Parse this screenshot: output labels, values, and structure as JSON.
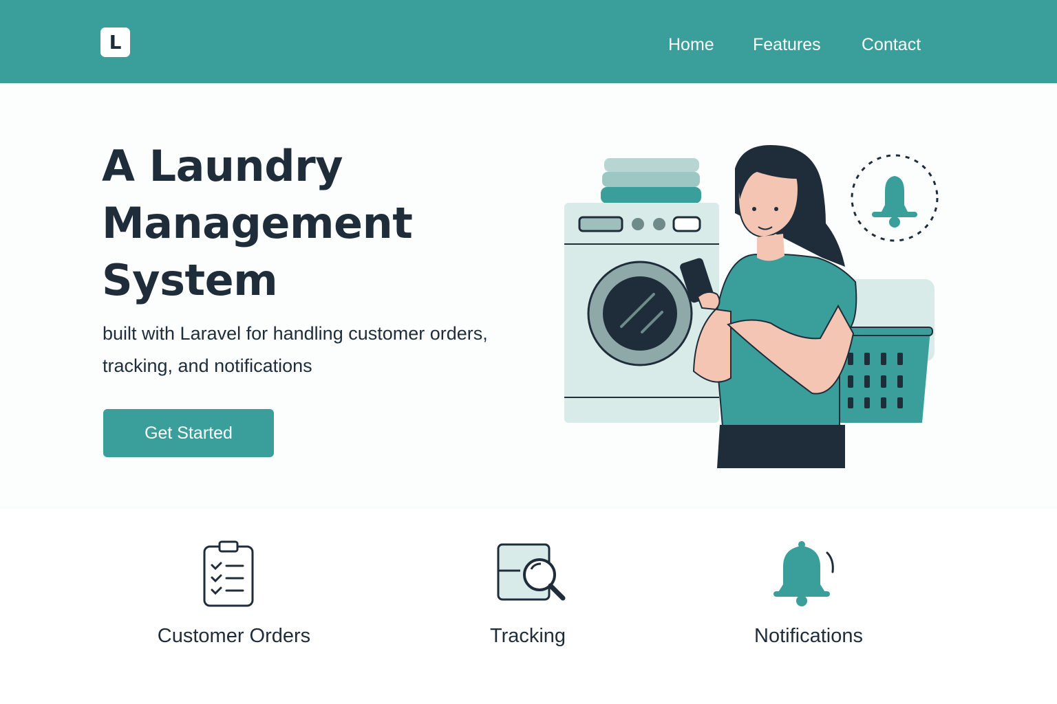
{
  "navbar": {
    "logo_letter": "L",
    "links": [
      {
        "label": "Home"
      },
      {
        "label": "Features"
      },
      {
        "label": "Contact"
      }
    ]
  },
  "hero": {
    "title": "A Laundry Management System",
    "subtitle": "built with Laravel for handling customer orders, tracking, and notifications",
    "cta_label": "Get Started"
  },
  "features": [
    {
      "label": "Customer Orders",
      "icon": "clipboard-checklist-icon"
    },
    {
      "label": "Tracking",
      "icon": "magnifier-tracking-icon"
    },
    {
      "label": "Notifications",
      "icon": "bell-icon"
    }
  ],
  "colors": {
    "accent": "#3a9e9b",
    "text": "#1f2d3a",
    "background": "#fcfdfd"
  }
}
